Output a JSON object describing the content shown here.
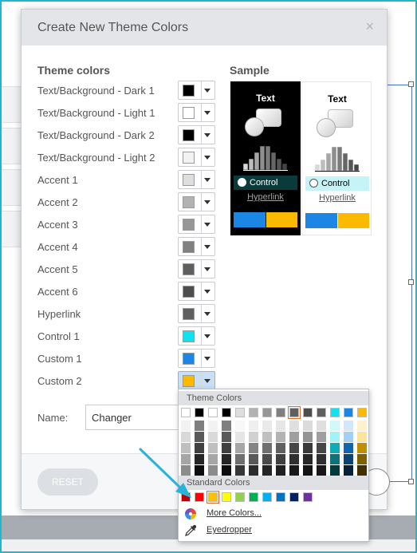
{
  "dialog": {
    "title": "Create New Theme Colors",
    "close_glyph": "×",
    "theme_colors_title": "Theme colors",
    "sample_title": "Sample",
    "name_label": "Name:",
    "name_value": "Changer",
    "reset_label": "RESET"
  },
  "rows": [
    {
      "label": "Text/Background - Dark 1",
      "color": "#000000"
    },
    {
      "label": "Text/Background - Light 1",
      "color": "#ffffff"
    },
    {
      "label": "Text/Background - Dark 2",
      "color": "#000000"
    },
    {
      "label": "Text/Background - Light 2",
      "color": "#f2f2f2"
    },
    {
      "label": "Accent 1",
      "color": "#dedede"
    },
    {
      "label": "Accent 2",
      "color": "#b2b2b2"
    },
    {
      "label": "Accent 3",
      "color": "#969696"
    },
    {
      "label": "Accent 4",
      "color": "#808080"
    },
    {
      "label": "Accent 5",
      "color": "#5f5f5f"
    },
    {
      "label": "Accent 6",
      "color": "#4d4d4d"
    },
    {
      "label": "Hyperlink",
      "color": "#5f5f5f"
    },
    {
      "label": "Control 1",
      "color": "#14e1f0"
    },
    {
      "label": "Custom 1",
      "color": "#1c86e4"
    },
    {
      "label": "Custom 2",
      "color": "#fbb900"
    }
  ],
  "samples": {
    "dark": {
      "text": "Text",
      "control": "Control",
      "hyperlink": "Hyperlink",
      "bg": "#000000",
      "fg": "#ffffff",
      "control_bg": "#0b3a3a",
      "accent": [
        "#1c86e4",
        "#fbb900"
      ]
    },
    "light": {
      "text": "Text",
      "control": "Control",
      "hyperlink": "Hyperlink",
      "bg": "#ffffff",
      "fg": "#000000",
      "control_bg": "#c6f3f8",
      "accent": [
        "#1c86e4",
        "#fbb900"
      ]
    }
  },
  "palette": {
    "theme_header": "Theme Colors",
    "standard_header": "Standard Colors",
    "more_colors": "More Colors...",
    "eyedropper": "Eyedropper",
    "theme_row": [
      "#ffffff",
      "#000000",
      "#ffffff",
      "#000000",
      "#dedede",
      "#b2b2b2",
      "#969696",
      "#808080",
      "#5f5f5f",
      "#4d4d4d",
      "#5f5f5f",
      "#14e1f0",
      "#1c86e4",
      "#fbb900"
    ],
    "theme_selected_index": 8,
    "shade_columns": [
      [
        "#f2f2f2",
        "#d9d9d9",
        "#bfbfbf",
        "#a6a6a6",
        "#8c8c8c"
      ],
      [
        "#7f7f7f",
        "#595959",
        "#404040",
        "#262626",
        "#0d0d0d"
      ],
      [
        "#f2f2f2",
        "#d9d9d9",
        "#bfbfbf",
        "#a6a6a6",
        "#8c8c8c"
      ],
      [
        "#7f7f7f",
        "#595959",
        "#404040",
        "#262626",
        "#0d0d0d"
      ],
      [
        "#f8f8f8",
        "#e5e5e5",
        "#a6a6a6",
        "#6f6f6f",
        "#373737"
      ],
      [
        "#efefef",
        "#d1d1d1",
        "#858585",
        "#595959",
        "#2c2c2c"
      ],
      [
        "#eaeaea",
        "#c0c0c0",
        "#707070",
        "#4b4b4b",
        "#252525"
      ],
      [
        "#e6e6e6",
        "#b3b3b3",
        "#606060",
        "#404040",
        "#202020"
      ],
      [
        "#dfdfdf",
        "#9f9f9f",
        "#474747",
        "#2f2f2f",
        "#181818"
      ],
      [
        "#dbdbdb",
        "#949494",
        "#3a3a3a",
        "#272727",
        "#131313"
      ],
      [
        "#dfdfdf",
        "#9f9f9f",
        "#474747",
        "#2f2f2f",
        "#181818"
      ],
      [
        "#d0f9fc",
        "#a1f3f9",
        "#0eacb8",
        "#0a737b",
        "#05393d"
      ],
      [
        "#d2e7fa",
        "#a4cff4",
        "#1266b0",
        "#0c4475",
        "#06223b"
      ],
      [
        "#fef1cc",
        "#fee399",
        "#c28f00",
        "#816000",
        "#413000"
      ]
    ],
    "standard_row": [
      "#c00000",
      "#ff0000",
      "#ffc000",
      "#ffff00",
      "#92d050",
      "#00b050",
      "#00b0f0",
      "#0070c0",
      "#002060",
      "#7030a0"
    ],
    "standard_selected_index": 2
  }
}
